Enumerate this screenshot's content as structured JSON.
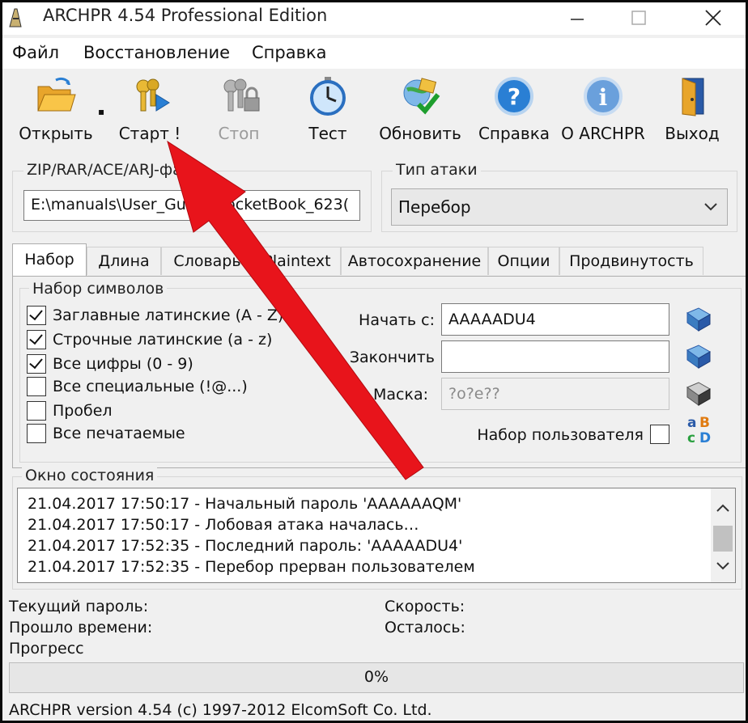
{
  "window": {
    "title": "ARCHPR 4.54 Professional Edition"
  },
  "menu": [
    {
      "label": "Файл"
    },
    {
      "label": "Восстановление"
    },
    {
      "label": "Справка"
    }
  ],
  "toolbar": {
    "open": "Открыть",
    "start": "Старт !",
    "stop": "Стоп",
    "test": "Тест",
    "update": "Обновить",
    "help": "Справка",
    "about": "О ARCHPR",
    "exit": "Выход"
  },
  "file_group": {
    "title": "ZIP/RAR/ACE/ARJ-файл",
    "path": "E:\\manuals\\User_Guide_PocketBook_623("
  },
  "attack_group": {
    "title": "Тип атаки",
    "selected": "Перебор"
  },
  "tabs": [
    {
      "label": "Набор",
      "active": true
    },
    {
      "label": "Длина"
    },
    {
      "label": "Словарь"
    },
    {
      "label": "Plaintext"
    },
    {
      "label": "Автосохранение"
    },
    {
      "label": "Опции"
    },
    {
      "label": "Продвинутость"
    }
  ],
  "charset": {
    "title": "Набор символов",
    "items": [
      {
        "label": "Заглавные латинские (A - Z)",
        "checked": true
      },
      {
        "label": "Строчные латинские (a - z)",
        "checked": true
      },
      {
        "label": "Все цифры (0 - 9)",
        "checked": true
      },
      {
        "label": "Все специальные (!@...)",
        "checked": false
      },
      {
        "label": "Пробел",
        "checked": false
      },
      {
        "label": "Все печатаемые",
        "checked": false
      }
    ],
    "start_label": "Начать с:",
    "start_value": "AAAAADU4",
    "end_label": "Закончить",
    "end_value": "",
    "mask_label": "Маска:",
    "mask_placeholder": "?o?e??",
    "user_charset_label": "Набор пользователя",
    "user_charset_checked": false
  },
  "status_window": {
    "title": "Окно состояния",
    "lines": [
      "21.04.2017 17:50:17 - Начальный пароль 'AAAAAAQM'",
      "21.04.2017 17:50:17 - Лобовая атака началась…",
      "21.04.2017 17:52:35 - Последний пароль: 'AAAAADU4'",
      "21.04.2017 17:52:35 - Перебор прерван пользователем"
    ]
  },
  "stats": {
    "current_password": "Текущий пароль:",
    "elapsed": "Прошло времени:",
    "progress": "Прогресс",
    "speed": "Скорость:",
    "remaining": "Осталось:"
  },
  "progress": {
    "percent": 0,
    "text": "0%"
  },
  "statusbar": {
    "text": "ARCHPR version 4.54 (c) 1997-2012 ElcomSoft Co. Ltd."
  },
  "colors": {
    "arrow": "#e8141b",
    "progress_fill": "#06b025",
    "help_icon": "#2a7fd4"
  },
  "icons": {
    "open": "folder-open-icon",
    "start": "keys-play-icon",
    "stop": "keys-lock-icon",
    "test": "stopwatch-icon",
    "update": "globe-check-icon",
    "help": "question-circle-icon",
    "about": "info-circle-icon",
    "exit": "door-exit-icon"
  }
}
